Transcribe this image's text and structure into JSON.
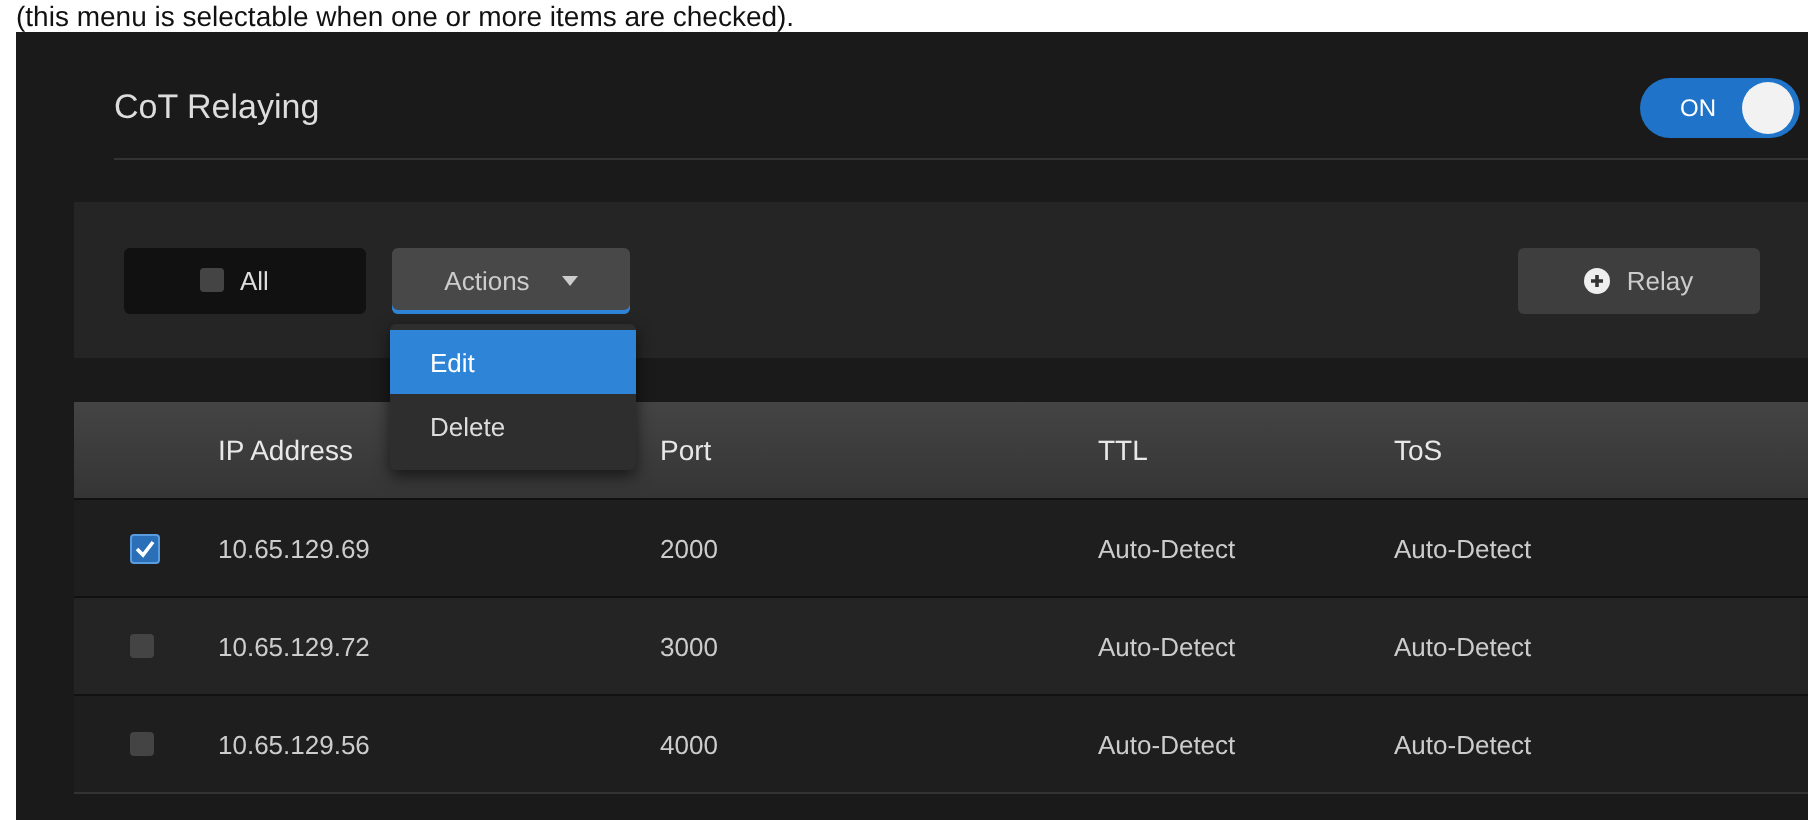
{
  "caption": "(this menu is selectable when one or more items are checked).",
  "section": {
    "title": "CoT Relaying",
    "toggle": {
      "label": "ON",
      "on": true
    }
  },
  "toolbar": {
    "select_all": {
      "label": "All",
      "checked": false
    },
    "actions_button": {
      "label": "Actions",
      "expanded": true
    },
    "relay_button": {
      "label": "Relay"
    }
  },
  "actions_menu": [
    {
      "label": "Edit",
      "selected": true
    },
    {
      "label": "Delete",
      "selected": false
    }
  ],
  "table": {
    "columns": [
      "IP Address",
      "Port",
      "TTL",
      "ToS"
    ],
    "rows": [
      {
        "checked": true,
        "ip": "10.65.129.69",
        "port": "2000",
        "ttl": "Auto-Detect",
        "tos": "Auto-Detect"
      },
      {
        "checked": false,
        "ip": "10.65.129.72",
        "port": "3000",
        "ttl": "Auto-Detect",
        "tos": "Auto-Detect"
      },
      {
        "checked": false,
        "ip": "10.65.129.56",
        "port": "4000",
        "ttl": "Auto-Detect",
        "tos": "Auto-Detect"
      }
    ]
  }
}
